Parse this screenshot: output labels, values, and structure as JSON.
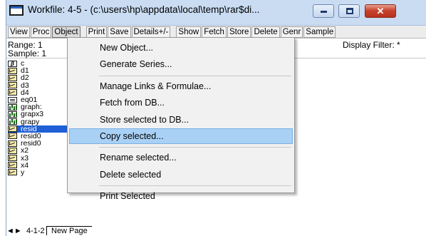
{
  "window": {
    "title": "Workfile: 4-5 - (c:\\users\\hp\\appdata\\local\\temp\\rar$di...",
    "close_glyph": "✕"
  },
  "toolbar": {
    "buttons": [
      "View",
      "Proc",
      "Object",
      "Print",
      "Save",
      "Details+/-",
      "Show",
      "Fetch",
      "Store",
      "Delete",
      "Genr",
      "Sample"
    ]
  },
  "info": {
    "range_label": "Range:  1",
    "sample_label": "Sample: 1",
    "display_filter": "Display Filter: *"
  },
  "objects": [
    {
      "name": "c",
      "type": "coef",
      "glyph": "β"
    },
    {
      "name": "d1",
      "type": "series"
    },
    {
      "name": "d2",
      "type": "series"
    },
    {
      "name": "d3",
      "type": "series"
    },
    {
      "name": "d4",
      "type": "series"
    },
    {
      "name": "eq01",
      "type": "equation"
    },
    {
      "name": "graph:",
      "type": "graph"
    },
    {
      "name": "grapx3",
      "type": "graph"
    },
    {
      "name": "grapy",
      "type": "graph"
    },
    {
      "name": "resid",
      "type": "series",
      "selected": true
    },
    {
      "name": "resid0",
      "type": "series"
    },
    {
      "name": "resid0",
      "type": "series"
    },
    {
      "name": "x2",
      "type": "series"
    },
    {
      "name": "x3",
      "type": "series"
    },
    {
      "name": "x4",
      "type": "series"
    },
    {
      "name": "y",
      "type": "series"
    }
  ],
  "context_menu": {
    "items": [
      {
        "label": "New Object..."
      },
      {
        "label": "Generate Series..."
      },
      {
        "separator": true
      },
      {
        "label": "Manage Links & Formulae..."
      },
      {
        "label": "Fetch from DB..."
      },
      {
        "label": "Store selected to DB..."
      },
      {
        "label": "Copy selected...",
        "highlighted": true
      },
      {
        "separator": true
      },
      {
        "label": "Rename selected..."
      },
      {
        "label": "Delete selected"
      },
      {
        "separator": true
      },
      {
        "label": "Print Selected"
      }
    ]
  },
  "tabs": {
    "left": "◄►",
    "active": "4-1-2",
    "new_page": "New Page"
  }
}
